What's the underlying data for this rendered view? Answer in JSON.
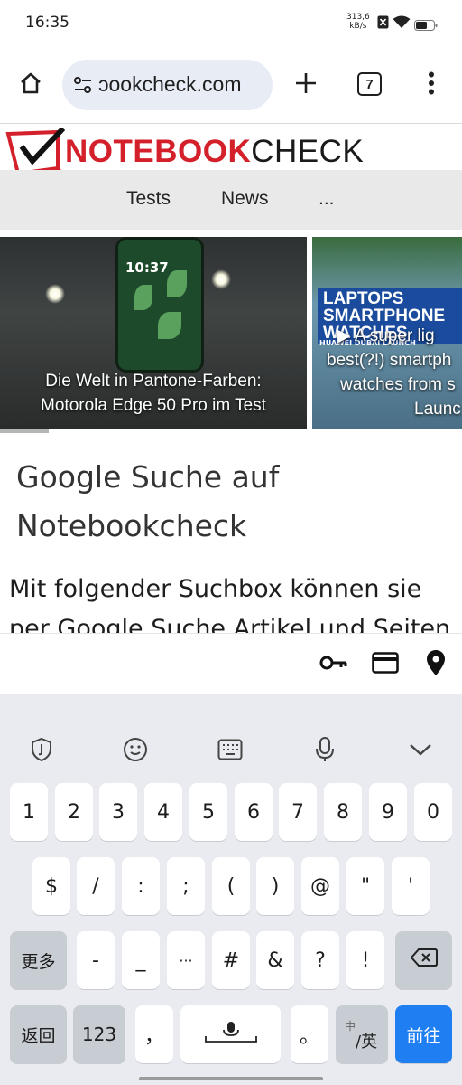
{
  "status_bar": {
    "time": "16:35",
    "net_speed_value": "313,6",
    "net_speed_unit": "kB/s"
  },
  "browser": {
    "url": "ɔookcheck.com",
    "tab_count": "7",
    "home_icon": "home-icon",
    "site_settings_icon": "tune-icon",
    "new_tab_icon": "plus-icon",
    "menu_icon": "more-vertical-icon"
  },
  "site": {
    "logo_red": "NOTEBOOK",
    "logo_black": "CHECK",
    "nav": [
      "Tests",
      "News",
      "..."
    ],
    "cards": [
      {
        "phone_time": "10:37",
        "caption_line1": "Die Welt in Pantone-Farben:",
        "caption_line2": "Motorola Edge 50 Pro im Test"
      },
      {
        "banner_line1": "LAPTOPS",
        "banner_line2": "SMARTPHONE",
        "banner_line3": "WATCHES",
        "sub": "HUAWEI DUBAI LAUNCH",
        "caption_line1": "▶ A super lig",
        "caption_line2": "best(?!) smartph",
        "caption_line3": "watches from s",
        "caption_line4": "Launc"
      }
    ],
    "heading_line1": "Google Suche auf",
    "heading_line2": "Notebookcheck",
    "paragraph_line1": "Mit folgender Suchbox können sie",
    "paragraph_line2": "per Google Suche Artikel und Seiten"
  },
  "autofill": {
    "icons": [
      "key-icon",
      "credit-card-icon",
      "location-pin-icon"
    ]
  },
  "keyboard": {
    "toolbar_icons": [
      "shield-icon",
      "emoji-icon",
      "keyboard-icon",
      "microphone-icon",
      "chevron-down-icon"
    ],
    "row1": [
      "1",
      "2",
      "3",
      "4",
      "5",
      "6",
      "7",
      "8",
      "9",
      "0"
    ],
    "row2": [
      "$",
      "/",
      ":",
      ";",
      "(",
      ")",
      "@",
      "\"",
      "'"
    ],
    "row3_left": "更多",
    "row3": [
      "-",
      "_",
      "···",
      "#",
      "&",
      "?",
      "!"
    ],
    "backspace_icon": "backspace-icon",
    "back_key": "返回",
    "num_key": "123",
    "comma_key": "，",
    "space_icon": "space-mic-icon",
    "period_key": "。",
    "lang_key_top": "中",
    "lang_key_main": "/英",
    "go_key": "前往"
  },
  "colors": {
    "accent_blue": "#1f7ff2",
    "logo_red": "#d4202a",
    "url_bar_bg": "#e8ecf5"
  }
}
